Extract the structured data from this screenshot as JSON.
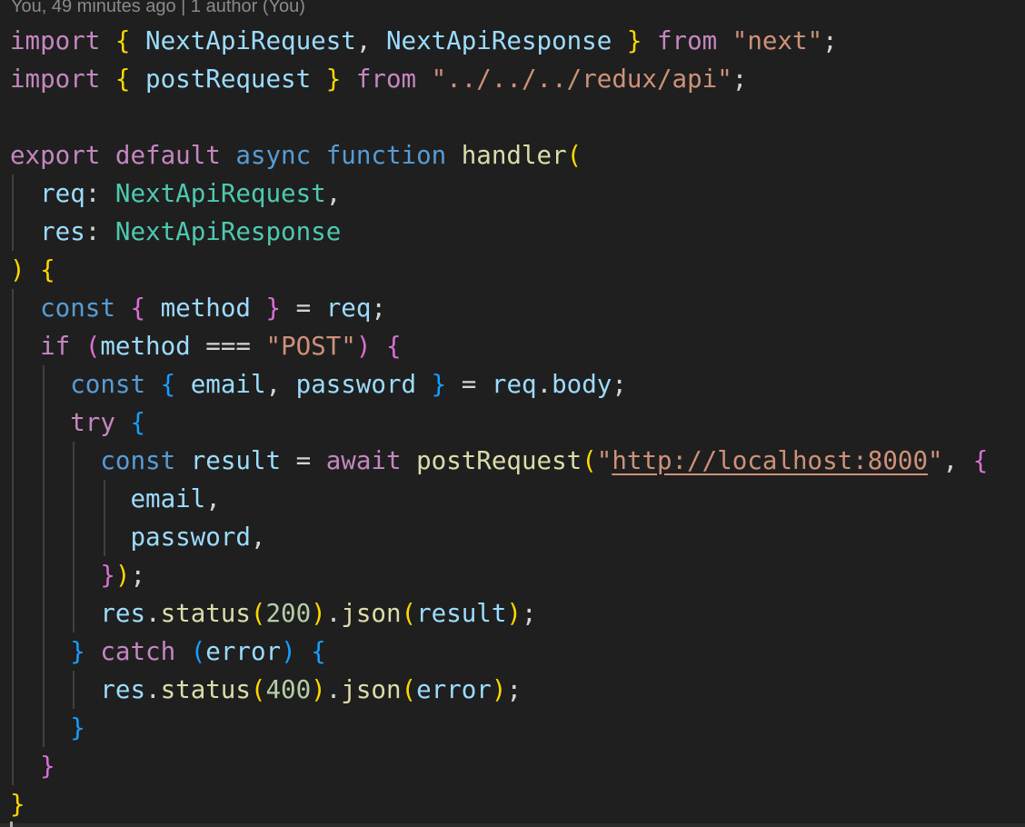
{
  "blame": {
    "text": "You, 49 minutes ago | 1 author (You)"
  },
  "code": {
    "lines": [
      {
        "guides": [],
        "tokens": [
          {
            "t": "import",
            "c": "kw"
          },
          {
            "t": " ",
            "c": "p"
          },
          {
            "t": "{",
            "c": "b1"
          },
          {
            "t": " ",
            "c": "p"
          },
          {
            "t": "NextApiRequest",
            "c": "var"
          },
          {
            "t": ", ",
            "c": "p"
          },
          {
            "t": "NextApiResponse",
            "c": "var"
          },
          {
            "t": " ",
            "c": "p"
          },
          {
            "t": "}",
            "c": "b1"
          },
          {
            "t": " ",
            "c": "p"
          },
          {
            "t": "from",
            "c": "kw"
          },
          {
            "t": " ",
            "c": "p"
          },
          {
            "t": "\"next\"",
            "c": "str"
          },
          {
            "t": ";",
            "c": "p"
          }
        ]
      },
      {
        "guides": [],
        "tokens": [
          {
            "t": "import",
            "c": "kw"
          },
          {
            "t": " ",
            "c": "p"
          },
          {
            "t": "{",
            "c": "b1"
          },
          {
            "t": " ",
            "c": "p"
          },
          {
            "t": "postRequest",
            "c": "var"
          },
          {
            "t": " ",
            "c": "p"
          },
          {
            "t": "}",
            "c": "b1"
          },
          {
            "t": " ",
            "c": "p"
          },
          {
            "t": "from",
            "c": "kw"
          },
          {
            "t": " ",
            "c": "p"
          },
          {
            "t": "\"../../../redux/api\"",
            "c": "str"
          },
          {
            "t": ";",
            "c": "p"
          }
        ]
      },
      {
        "guides": [],
        "tokens": []
      },
      {
        "guides": [],
        "tokens": [
          {
            "t": "export",
            "c": "kw"
          },
          {
            "t": " ",
            "c": "p"
          },
          {
            "t": "default",
            "c": "kw"
          },
          {
            "t": " ",
            "c": "p"
          },
          {
            "t": "async",
            "c": "st"
          },
          {
            "t": " ",
            "c": "p"
          },
          {
            "t": "function",
            "c": "st"
          },
          {
            "t": " ",
            "c": "p"
          },
          {
            "t": "handler",
            "c": "fn"
          },
          {
            "t": "(",
            "c": "b1"
          }
        ]
      },
      {
        "guides": [
          0
        ],
        "tokens": [
          {
            "t": "  ",
            "c": "p"
          },
          {
            "t": "req",
            "c": "var"
          },
          {
            "t": ": ",
            "c": "p"
          },
          {
            "t": "NextApiRequest",
            "c": "type"
          },
          {
            "t": ",",
            "c": "p"
          }
        ]
      },
      {
        "guides": [
          0
        ],
        "tokens": [
          {
            "t": "  ",
            "c": "p"
          },
          {
            "t": "res",
            "c": "var"
          },
          {
            "t": ": ",
            "c": "p"
          },
          {
            "t": "NextApiResponse",
            "c": "type"
          }
        ]
      },
      {
        "guides": [],
        "tokens": [
          {
            "t": ")",
            "c": "b1"
          },
          {
            "t": " ",
            "c": "p"
          },
          {
            "t": "{",
            "c": "b1"
          }
        ]
      },
      {
        "guides": [
          0
        ],
        "tokens": [
          {
            "t": "  ",
            "c": "p"
          },
          {
            "t": "const",
            "c": "st"
          },
          {
            "t": " ",
            "c": "p"
          },
          {
            "t": "{",
            "c": "b2"
          },
          {
            "t": " ",
            "c": "p"
          },
          {
            "t": "method",
            "c": "var"
          },
          {
            "t": " ",
            "c": "p"
          },
          {
            "t": "}",
            "c": "b2"
          },
          {
            "t": " = ",
            "c": "p"
          },
          {
            "t": "req",
            "c": "var"
          },
          {
            "t": ";",
            "c": "p"
          }
        ]
      },
      {
        "guides": [
          0
        ],
        "tokens": [
          {
            "t": "  ",
            "c": "p"
          },
          {
            "t": "if",
            "c": "kw"
          },
          {
            "t": " ",
            "c": "p"
          },
          {
            "t": "(",
            "c": "b2"
          },
          {
            "t": "method",
            "c": "var"
          },
          {
            "t": " === ",
            "c": "p"
          },
          {
            "t": "\"POST\"",
            "c": "str"
          },
          {
            "t": ")",
            "c": "b2"
          },
          {
            "t": " ",
            "c": "p"
          },
          {
            "t": "{",
            "c": "b2"
          }
        ]
      },
      {
        "guides": [
          0,
          1
        ],
        "tokens": [
          {
            "t": "    ",
            "c": "p"
          },
          {
            "t": "const",
            "c": "st"
          },
          {
            "t": " ",
            "c": "p"
          },
          {
            "t": "{",
            "c": "b3"
          },
          {
            "t": " ",
            "c": "p"
          },
          {
            "t": "email",
            "c": "var"
          },
          {
            "t": ", ",
            "c": "p"
          },
          {
            "t": "password",
            "c": "var"
          },
          {
            "t": " ",
            "c": "p"
          },
          {
            "t": "}",
            "c": "b3"
          },
          {
            "t": " = ",
            "c": "p"
          },
          {
            "t": "req",
            "c": "var"
          },
          {
            "t": ".",
            "c": "p"
          },
          {
            "t": "body",
            "c": "var"
          },
          {
            "t": ";",
            "c": "p"
          }
        ]
      },
      {
        "guides": [
          0,
          1
        ],
        "tokens": [
          {
            "t": "    ",
            "c": "p"
          },
          {
            "t": "try",
            "c": "kw"
          },
          {
            "t": " ",
            "c": "p"
          },
          {
            "t": "{",
            "c": "b3"
          }
        ]
      },
      {
        "guides": [
          0,
          1,
          2
        ],
        "tokens": [
          {
            "t": "      ",
            "c": "p"
          },
          {
            "t": "const",
            "c": "st"
          },
          {
            "t": " ",
            "c": "p"
          },
          {
            "t": "result",
            "c": "var"
          },
          {
            "t": " = ",
            "c": "p"
          },
          {
            "t": "await",
            "c": "kw"
          },
          {
            "t": " ",
            "c": "p"
          },
          {
            "t": "postRequest",
            "c": "fn"
          },
          {
            "t": "(",
            "c": "b1"
          },
          {
            "t": "\"",
            "c": "str"
          },
          {
            "t": "http://localhost:8000",
            "c": "str link"
          },
          {
            "t": "\"",
            "c": "str"
          },
          {
            "t": ", ",
            "c": "p"
          },
          {
            "t": "{",
            "c": "b2"
          }
        ]
      },
      {
        "guides": [
          0,
          1,
          2,
          3
        ],
        "tokens": [
          {
            "t": "        ",
            "c": "p"
          },
          {
            "t": "email",
            "c": "var"
          },
          {
            "t": ",",
            "c": "p"
          }
        ]
      },
      {
        "guides": [
          0,
          1,
          2,
          3
        ],
        "tokens": [
          {
            "t": "        ",
            "c": "p"
          },
          {
            "t": "password",
            "c": "var"
          },
          {
            "t": ",",
            "c": "p"
          }
        ]
      },
      {
        "guides": [
          0,
          1,
          2
        ],
        "tokens": [
          {
            "t": "      ",
            "c": "p"
          },
          {
            "t": "}",
            "c": "b2"
          },
          {
            "t": ")",
            "c": "b1"
          },
          {
            "t": ";",
            "c": "p"
          }
        ]
      },
      {
        "guides": [
          0,
          1,
          2
        ],
        "tokens": [
          {
            "t": "      ",
            "c": "p"
          },
          {
            "t": "res",
            "c": "var"
          },
          {
            "t": ".",
            "c": "p"
          },
          {
            "t": "status",
            "c": "fn"
          },
          {
            "t": "(",
            "c": "b1"
          },
          {
            "t": "200",
            "c": "num"
          },
          {
            "t": ")",
            "c": "b1"
          },
          {
            "t": ".",
            "c": "p"
          },
          {
            "t": "json",
            "c": "fn"
          },
          {
            "t": "(",
            "c": "b1"
          },
          {
            "t": "result",
            "c": "var"
          },
          {
            "t": ")",
            "c": "b1"
          },
          {
            "t": ";",
            "c": "p"
          }
        ]
      },
      {
        "guides": [
          0,
          1
        ],
        "tokens": [
          {
            "t": "    ",
            "c": "p"
          },
          {
            "t": "}",
            "c": "b3"
          },
          {
            "t": " ",
            "c": "p"
          },
          {
            "t": "catch",
            "c": "kw"
          },
          {
            "t": " ",
            "c": "p"
          },
          {
            "t": "(",
            "c": "b3"
          },
          {
            "t": "error",
            "c": "var"
          },
          {
            "t": ")",
            "c": "b3"
          },
          {
            "t": " ",
            "c": "p"
          },
          {
            "t": "{",
            "c": "b3"
          }
        ]
      },
      {
        "guides": [
          0,
          1,
          2
        ],
        "tokens": [
          {
            "t": "      ",
            "c": "p"
          },
          {
            "t": "res",
            "c": "var"
          },
          {
            "t": ".",
            "c": "p"
          },
          {
            "t": "status",
            "c": "fn"
          },
          {
            "t": "(",
            "c": "b1"
          },
          {
            "t": "400",
            "c": "num"
          },
          {
            "t": ")",
            "c": "b1"
          },
          {
            "t": ".",
            "c": "p"
          },
          {
            "t": "json",
            "c": "fn"
          },
          {
            "t": "(",
            "c": "b1"
          },
          {
            "t": "error",
            "c": "var"
          },
          {
            "t": ")",
            "c": "b1"
          },
          {
            "t": ";",
            "c": "p"
          }
        ]
      },
      {
        "guides": [
          0,
          1
        ],
        "tokens": [
          {
            "t": "    ",
            "c": "p"
          },
          {
            "t": "}",
            "c": "b3"
          }
        ]
      },
      {
        "guides": [
          0
        ],
        "tokens": [
          {
            "t": "  ",
            "c": "p"
          },
          {
            "t": "}",
            "c": "b2"
          }
        ]
      },
      {
        "guides": [],
        "tokens": [
          {
            "t": "}",
            "c": "b1"
          }
        ]
      }
    ]
  }
}
